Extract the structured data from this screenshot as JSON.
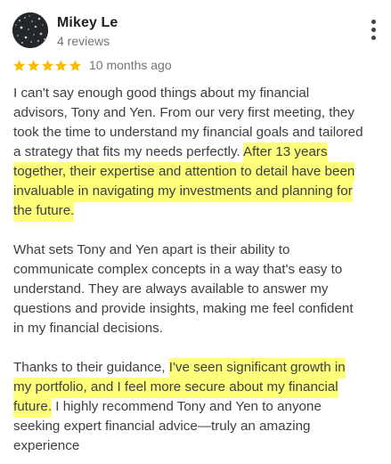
{
  "reviewer": {
    "name": "Mikey Le",
    "meta": "4 reviews"
  },
  "rating": {
    "stars": 5,
    "max": 5,
    "star_color": "#fbbc04",
    "time": "10 months ago"
  },
  "highlight_color": "#ffff7a",
  "review": {
    "p1": {
      "l1": "I can't say enough good things about my financial",
      "l2": "advisors, Tony and Yen. From our very first meeting, they",
      "l3": "took the time to understand my financial goals and tailored",
      "l4a": "a strategy that fits my needs perfectly. ",
      "l4b": "After 13 years",
      "l5": "together, their expertise and attention to detail have been",
      "l6": "invaluable in navigating my investments and planning for",
      "l7": "the future."
    },
    "p2": {
      "l1": "What sets Tony and Yen apart is their ability to",
      "l2": "communicate complex concepts in a way that's easy to",
      "l3": "understand. They are always available to answer my",
      "l4": "questions and provide insights, making me feel confident",
      "l5": "in my financial decisions."
    },
    "p3": {
      "l1a": "Thanks to their guidance, ",
      "l1b": "I've seen significant growth in",
      "l2": "my portfolio, and I feel more secure about my financial",
      "l3a": "future.",
      "l3b": " I highly recommend Tony and Yen to anyone",
      "l4": "seeking expert financial advice—truly an amazing",
      "l5": "experience"
    }
  }
}
